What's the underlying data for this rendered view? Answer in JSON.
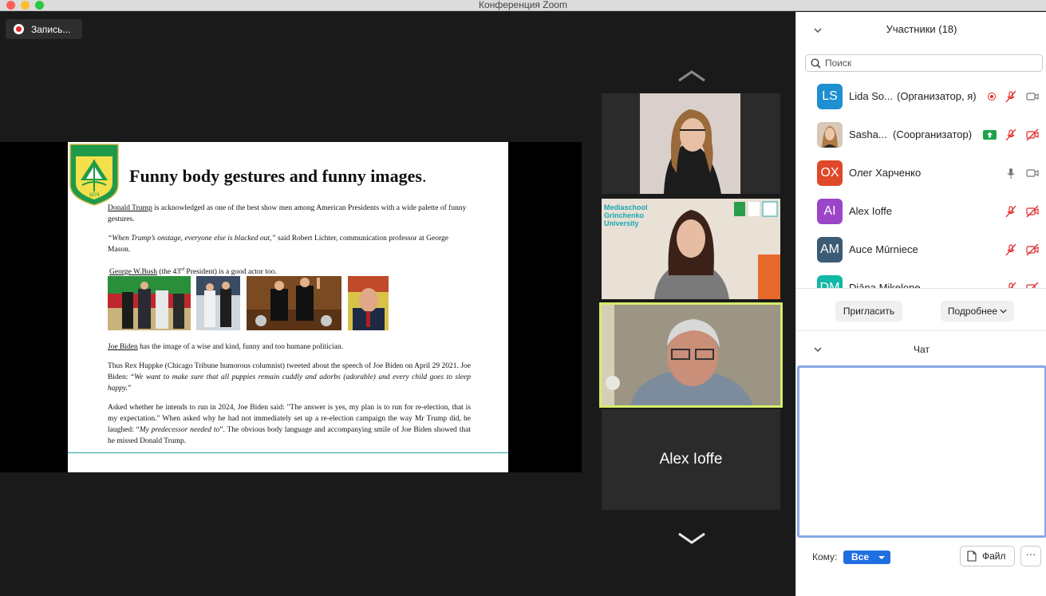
{
  "window": {
    "title": "Конференция Zoom"
  },
  "recording": {
    "label": "Запись..."
  },
  "slide": {
    "logo_text": "Київський університет імені Бориса Грінченка",
    "logo_year": "1874",
    "title": "Funny body gestures and funny images",
    "title_dot": ".",
    "p1_link": "Donald Trump",
    "p1_rest": " is acknowledged as one of the best show men among American Presidents with a wide palette of funny gestures.",
    "p2_quote": "“When Trump’s onstage, everyone else is blacked out,”",
    "p2_rest": " said Robert Lichter, communication professor at George Mason.",
    "p3_link": "George W.Bush",
    "p3_a": " (the 43",
    "p3_sup": "rd",
    "p3_b": " President) is a good actor too.",
    "p4_link": "Joe Biden",
    "p4_rest": " has the image of a wise and kind, funny and too humane politician.",
    "p5_a": "Thus Rex Huppke (Chicago Tribune  humorous columnist) tweeted about the speech of Joe Biden on April 29 2021. Joe Biden: “",
    "p5_quote": "We want to make sure that all puppies remain cuddly and adorbs (adorable) and every child goes to sleep happy.",
    "p5_end": "”",
    "p6_a": "Asked whether he intends to run in 2024, Joe Biden said: \"The answer is yes, my plan is to run for re-election, that is my expectation.\" When asked why he had not immediately set up a re-election campaign the way Mr Trump did, he laughed: “",
    "p6_quote": "My predecessor needed to",
    "p6_b": "”. The obvious body language and accompanying smile of Joe Biden showed that he missed Donald Trump."
  },
  "gallery": {
    "tile2_overlay": [
      "Mediaschool",
      "Grinchenko",
      "University"
    ],
    "tile4_name": "Alex Ioffe"
  },
  "participants": {
    "header": "Участники (18)",
    "search_placeholder": "Поиск",
    "list": [
      {
        "initials": "LS",
        "name": "Lida So...",
        "role": "(Организатор, я)",
        "color": "#1e8fd0"
      },
      {
        "initials": "",
        "name": "Sasha...",
        "role": "(Соорганизатор)",
        "color": "#c9a27a"
      },
      {
        "initials": "OX",
        "name": "Олег Харченко",
        "role": "",
        "color": "#e0482a"
      },
      {
        "initials": "AI",
        "name": "Alex Ioffe",
        "role": "",
        "color": "#9b45c9"
      },
      {
        "initials": "AM",
        "name": "Auce Mūrniece",
        "role": "",
        "color": "#3b5a73"
      },
      {
        "initials": "DM",
        "name": "Diāna Mikelone",
        "role": "",
        "color": "#12b8a6"
      }
    ],
    "invite_label": "Пригласить",
    "more_label": "Подробнее"
  },
  "chat": {
    "header": "Чат",
    "to_label": "Кому:",
    "to_value": "Все",
    "file_label": "Файл",
    "more_label": "···"
  }
}
